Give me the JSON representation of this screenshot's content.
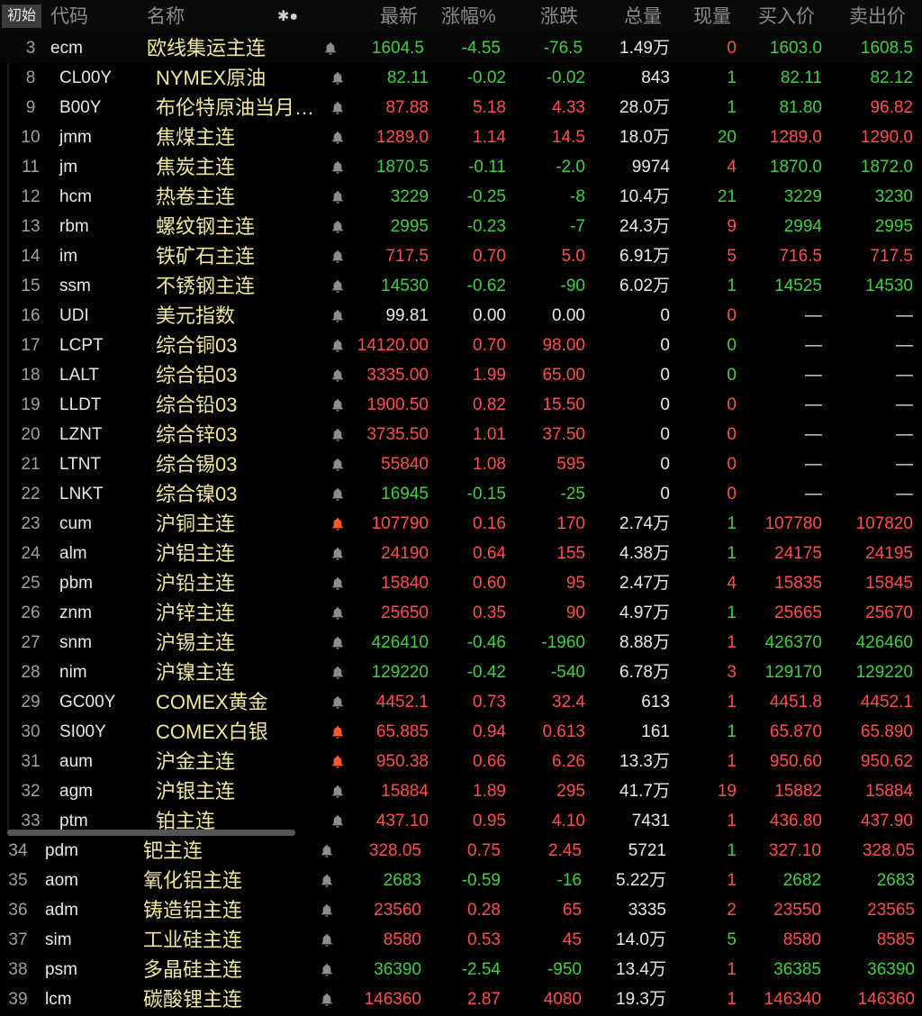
{
  "header": {
    "tag": "初始",
    "cols": [
      "代码",
      "名称",
      "✱●",
      "最新",
      "涨幅%",
      "涨跌",
      "总量",
      "现量",
      "买入价",
      "卖出价"
    ]
  },
  "rows": [
    {
      "idx": "3",
      "code": "ecm",
      "name": "欧线集运主连",
      "bell": "grey",
      "last": "1604.5",
      "pct": "-4.55",
      "chg": "-76.5",
      "vol": "1.49万",
      "cur": "0",
      "bid": "1603.0",
      "ask": "1608.5",
      "dir": "g",
      "curdir": "r"
    },
    {
      "idx": "8",
      "code": "CL00Y",
      "name": "NYMEX原油",
      "bell": "grey",
      "last": "82.11",
      "pct": "-0.02",
      "chg": "-0.02",
      "vol": "843",
      "cur": "1",
      "bid": "82.11",
      "ask": "82.12",
      "dir": "g",
      "curdir": "g"
    },
    {
      "idx": "9",
      "code": "B00Y",
      "name": "布伦特原油当月…",
      "bell": "grey",
      "last": "87.88",
      "pct": "5.18",
      "chg": "4.33",
      "vol": "28.0万",
      "cur": "1",
      "bid": "81.80",
      "ask": "96.82",
      "dir": "r",
      "curdir": "g",
      "biddir": "g"
    },
    {
      "idx": "10",
      "code": "jmm",
      "name": "焦煤主连",
      "bell": "grey",
      "last": "1289.0",
      "pct": "1.14",
      "chg": "14.5",
      "vol": "18.0万",
      "cur": "20",
      "bid": "1289.0",
      "ask": "1290.0",
      "dir": "r",
      "curdir": "g"
    },
    {
      "idx": "11",
      "code": "jm",
      "name": "焦炭主连",
      "bell": "grey",
      "last": "1870.5",
      "pct": "-0.11",
      "chg": "-2.0",
      "vol": "9974",
      "cur": "4",
      "bid": "1870.0",
      "ask": "1872.0",
      "dir": "g",
      "curdir": "r"
    },
    {
      "idx": "12",
      "code": "hcm",
      "name": "热卷主连",
      "bell": "grey",
      "last": "3229",
      "pct": "-0.25",
      "chg": "-8",
      "vol": "10.4万",
      "cur": "21",
      "bid": "3229",
      "ask": "3230",
      "dir": "g",
      "curdir": "g"
    },
    {
      "idx": "13",
      "code": "rbm",
      "name": "螺纹钢主连",
      "bell": "grey",
      "last": "2995",
      "pct": "-0.23",
      "chg": "-7",
      "vol": "24.3万",
      "cur": "9",
      "bid": "2994",
      "ask": "2995",
      "dir": "g",
      "curdir": "r"
    },
    {
      "idx": "14",
      "code": "im",
      "name": "铁矿石主连",
      "bell": "grey",
      "last": "717.5",
      "pct": "0.70",
      "chg": "5.0",
      "vol": "6.91万",
      "cur": "5",
      "bid": "716.5",
      "ask": "717.5",
      "dir": "r",
      "curdir": "r"
    },
    {
      "idx": "15",
      "code": "ssm",
      "name": "不锈钢主连",
      "bell": "grey",
      "last": "14530",
      "pct": "-0.62",
      "chg": "-90",
      "vol": "6.02万",
      "cur": "1",
      "bid": "14525",
      "ask": "14530",
      "dir": "g",
      "curdir": "g"
    },
    {
      "idx": "16",
      "code": "UDI",
      "name": "美元指数",
      "bell": "grey",
      "last": "99.81",
      "pct": "0.00",
      "chg": "0.00",
      "vol": "0",
      "cur": "0",
      "bid": "—",
      "ask": "—",
      "dir": "w",
      "curdir": "r"
    },
    {
      "idx": "17",
      "code": "LCPT",
      "name": "综合铜03",
      "bell": "grey",
      "last": "14120.00",
      "pct": "0.70",
      "chg": "98.00",
      "vol": "0",
      "cur": "0",
      "bid": "—",
      "ask": "—",
      "dir": "r",
      "curdir": "g"
    },
    {
      "idx": "18",
      "code": "LALT",
      "name": "综合铝03",
      "bell": "grey",
      "last": "3335.00",
      "pct": "1.99",
      "chg": "65.00",
      "vol": "0",
      "cur": "0",
      "bid": "—",
      "ask": "—",
      "dir": "r",
      "curdir": "g"
    },
    {
      "idx": "19",
      "code": "LLDT",
      "name": "综合铅03",
      "bell": "grey",
      "last": "1900.50",
      "pct": "0.82",
      "chg": "15.50",
      "vol": "0",
      "cur": "0",
      "bid": "—",
      "ask": "—",
      "dir": "r",
      "curdir": "r"
    },
    {
      "idx": "20",
      "code": "LZNT",
      "name": "综合锌03",
      "bell": "grey",
      "last": "3735.50",
      "pct": "1.01",
      "chg": "37.50",
      "vol": "0",
      "cur": "0",
      "bid": "—",
      "ask": "—",
      "dir": "r",
      "curdir": "r"
    },
    {
      "idx": "21",
      "code": "LTNT",
      "name": "综合锡03",
      "bell": "grey",
      "last": "55840",
      "pct": "1.08",
      "chg": "595",
      "vol": "0",
      "cur": "0",
      "bid": "—",
      "ask": "—",
      "dir": "r",
      "curdir": "r"
    },
    {
      "idx": "22",
      "code": "LNKT",
      "name": "综合镍03",
      "bell": "grey",
      "last": "16945",
      "pct": "-0.15",
      "chg": "-25",
      "vol": "0",
      "cur": "0",
      "bid": "—",
      "ask": "—",
      "dir": "g",
      "curdir": "r"
    },
    {
      "idx": "23",
      "code": "cum",
      "name": "沪铜主连",
      "bell": "red",
      "last": "107790",
      "pct": "0.16",
      "chg": "170",
      "vol": "2.74万",
      "cur": "1",
      "bid": "107780",
      "ask": "107820",
      "dir": "r",
      "curdir": "g"
    },
    {
      "idx": "24",
      "code": "alm",
      "name": "沪铝主连",
      "bell": "grey",
      "last": "24190",
      "pct": "0.64",
      "chg": "155",
      "vol": "4.38万",
      "cur": "1",
      "bid": "24175",
      "ask": "24195",
      "dir": "r",
      "curdir": "g"
    },
    {
      "idx": "25",
      "code": "pbm",
      "name": "沪铅主连",
      "bell": "grey",
      "last": "15840",
      "pct": "0.60",
      "chg": "95",
      "vol": "2.47万",
      "cur": "4",
      "bid": "15835",
      "ask": "15845",
      "dir": "r",
      "curdir": "r"
    },
    {
      "idx": "26",
      "code": "znm",
      "name": "沪锌主连",
      "bell": "grey",
      "last": "25650",
      "pct": "0.35",
      "chg": "90",
      "vol": "4.97万",
      "cur": "1",
      "bid": "25665",
      "ask": "25670",
      "dir": "r",
      "curdir": "g"
    },
    {
      "idx": "27",
      "code": "snm",
      "name": "沪锡主连",
      "bell": "grey",
      "last": "426410",
      "pct": "-0.46",
      "chg": "-1960",
      "vol": "8.88万",
      "cur": "1",
      "bid": "426370",
      "ask": "426460",
      "dir": "g",
      "curdir": "r"
    },
    {
      "idx": "28",
      "code": "nim",
      "name": "沪镍主连",
      "bell": "grey",
      "last": "129220",
      "pct": "-0.42",
      "chg": "-540",
      "vol": "6.78万",
      "cur": "3",
      "bid": "129170",
      "ask": "129220",
      "dir": "g",
      "curdir": "r"
    },
    {
      "idx": "29",
      "code": "GC00Y",
      "name": "COMEX黄金",
      "bell": "grey",
      "last": "4452.1",
      "pct": "0.73",
      "chg": "32.4",
      "vol": "613",
      "cur": "1",
      "bid": "4451.8",
      "ask": "4452.1",
      "dir": "r",
      "curdir": "r"
    },
    {
      "idx": "30",
      "code": "SI00Y",
      "name": "COMEX白银",
      "bell": "red",
      "last": "65.885",
      "pct": "0.94",
      "chg": "0.613",
      "vol": "161",
      "cur": "1",
      "bid": "65.870",
      "ask": "65.890",
      "dir": "r",
      "curdir": "g"
    },
    {
      "idx": "31",
      "code": "aum",
      "name": "沪金主连",
      "bell": "red",
      "last": "950.38",
      "pct": "0.66",
      "chg": "6.26",
      "vol": "13.3万",
      "cur": "1",
      "bid": "950.60",
      "ask": "950.62",
      "dir": "r",
      "curdir": "r"
    },
    {
      "idx": "32",
      "code": "agm",
      "name": "沪银主连",
      "bell": "grey",
      "last": "15884",
      "pct": "1.89",
      "chg": "295",
      "vol": "41.7万",
      "cur": "19",
      "bid": "15882",
      "ask": "15884",
      "dir": "r",
      "curdir": "r"
    },
    {
      "idx": "33",
      "code": "ptm",
      "name": "铂主连",
      "bell": "grey",
      "last": "437.10",
      "pct": "0.95",
      "chg": "4.10",
      "vol": "7431",
      "cur": "1",
      "bid": "436.80",
      "ask": "437.90",
      "dir": "r",
      "curdir": "r"
    },
    {
      "idx": "34",
      "code": "pdm",
      "name": "钯主连",
      "bell": "grey",
      "last": "328.05",
      "pct": "0.75",
      "chg": "2.45",
      "vol": "5721",
      "cur": "1",
      "bid": "327.10",
      "ask": "328.05",
      "dir": "r",
      "curdir": "g"
    },
    {
      "idx": "35",
      "code": "aom",
      "name": "氧化铝主连",
      "bell": "grey",
      "last": "2683",
      "pct": "-0.59",
      "chg": "-16",
      "vol": "5.22万",
      "cur": "1",
      "bid": "2682",
      "ask": "2683",
      "dir": "g",
      "curdir": "r"
    },
    {
      "idx": "36",
      "code": "adm",
      "name": "铸造铝主连",
      "bell": "grey",
      "last": "23560",
      "pct": "0.28",
      "chg": "65",
      "vol": "3335",
      "cur": "2",
      "bid": "23550",
      "ask": "23565",
      "dir": "r",
      "curdir": "r"
    },
    {
      "idx": "37",
      "code": "sim",
      "name": "工业硅主连",
      "bell": "grey",
      "last": "8580",
      "pct": "0.53",
      "chg": "45",
      "vol": "14.0万",
      "cur": "5",
      "bid": "8580",
      "ask": "8585",
      "dir": "r",
      "curdir": "g"
    },
    {
      "idx": "38",
      "code": "psm",
      "name": "多晶硅主连",
      "bell": "grey",
      "last": "36390",
      "pct": "-2.54",
      "chg": "-950",
      "vol": "13.4万",
      "cur": "1",
      "bid": "36385",
      "ask": "36390",
      "dir": "g",
      "curdir": "r"
    },
    {
      "idx": "39",
      "code": "lcm",
      "name": "碳酸锂主连",
      "bell": "grey",
      "last": "146360",
      "pct": "2.87",
      "chg": "4080",
      "vol": "19.3万",
      "cur": "1",
      "bid": "146340",
      "ask": "146360",
      "dir": "r",
      "curdir": "r"
    }
  ],
  "colors": {
    "up": "#ff4e4e",
    "down": "#3fd03f",
    "name": "#f0e79b",
    "bell_grey": "#8c8c8c",
    "bell_red": "#ff5a2a"
  }
}
